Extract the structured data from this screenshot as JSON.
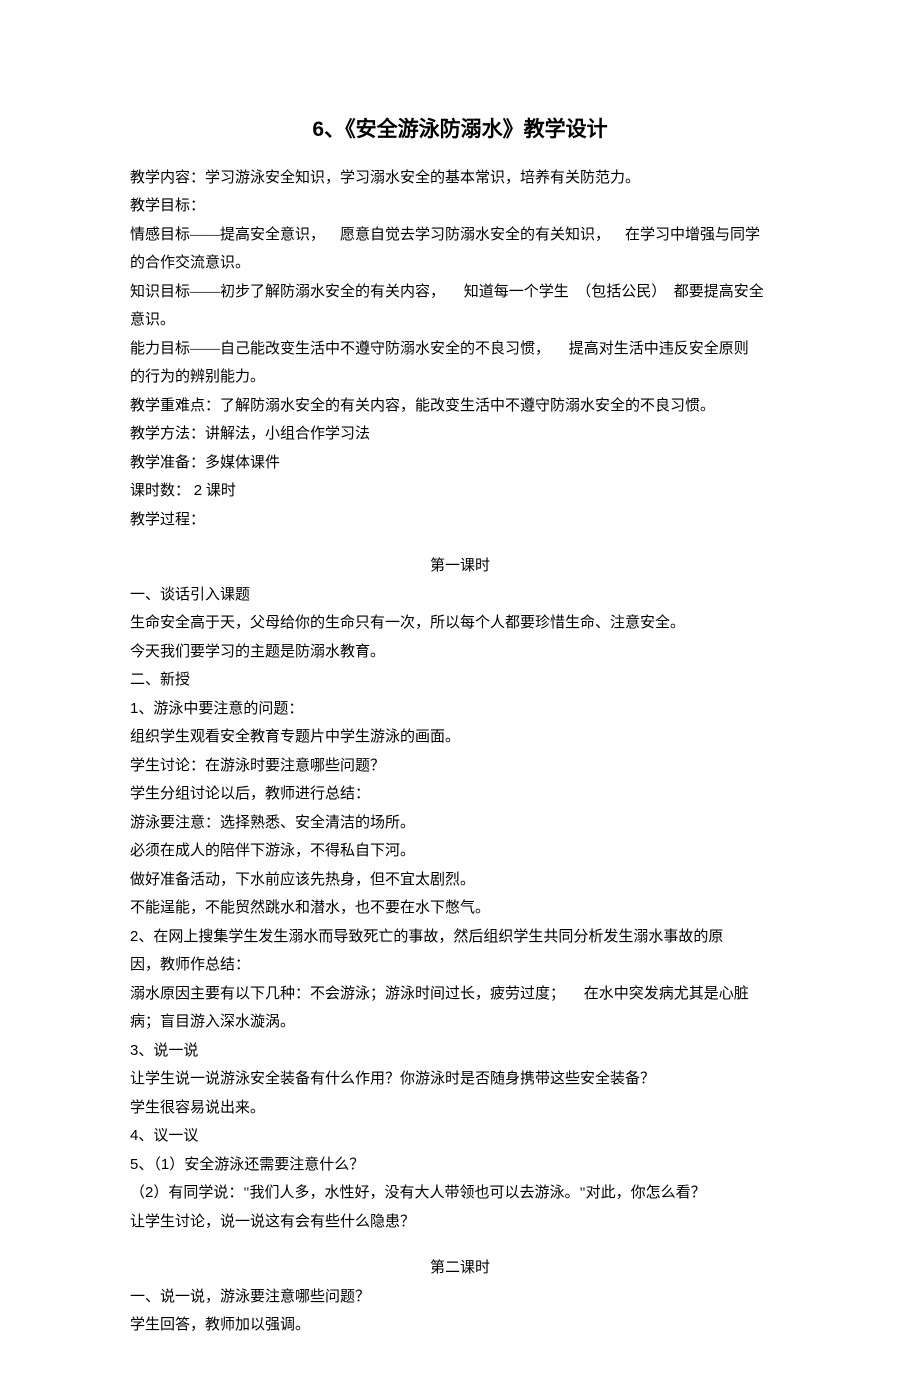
{
  "title": {
    "num": "6",
    "sep": "、",
    "name": "《安全游泳防溺水》教学设计"
  },
  "intro": {
    "content": "教学内容：学习游泳安全知识，学习溺水安全的基本常识，培养有关防范力。",
    "objHeader": "教学目标：",
    "obj1a": "情感目标——提高安全意识，",
    "obj1b": "愿意自觉去学习防溺水安全的有关知识，",
    "obj1c": "在学习中增强与同学",
    "obj1d": "的合作交流意识。",
    "obj2a": "知识目标——初步了解防溺水安全的有关内容，",
    "obj2b": "知道每一个学生",
    "obj2c": "（包括公民）",
    "obj2d": "都要提高安全",
    "obj2e": "意识。",
    "obj3a": "能力目标——自己能改变生活中不遵守防溺水安全的不良习惯，",
    "obj3b": "提高对生活中违反安全原则",
    "obj3c": "的行为的辨别能力。",
    "difficulty": "教学重难点：了解防溺水安全的有关内容，能改变生活中不遵守防溺水安全的不良习惯。",
    "method": "教学方法：讲解法，小组合作学习法",
    "prep": "教学准备：多媒体课件",
    "periodsLabel": "课时数：",
    "periodsNum": "2",
    "periodsUnit": " 课时",
    "processHeader": "教学过程："
  },
  "lesson1": {
    "header": "第一课时",
    "s1": "一、谈话引入课题",
    "s1a": "生命安全高于天，父母给你的生命只有一次，所以每个人都要珍惜生命、注意安全。",
    "s1b": "今天我们要学习的主题是防溺水教育。",
    "s2": "二、新授",
    "p1n": "1",
    "p1": "、游泳中要注意的问题：",
    "p1a": "组织学生观看安全教育专题片中学生游泳的画面。",
    "p1b": "学生讨论：在游泳时要注意哪些问题？",
    "p1c": "学生分组讨论以后，教师进行总结：",
    "p1d": "游泳要注意：选择熟悉、安全清洁的场所。",
    "p1e": "必须在成人的陪伴下游泳，不得私自下河。",
    "p1f": "做好准备活动，下水前应该先热身，但不宜太剧烈。",
    "p1g": "不能逞能，不能贸然跳水和潜水，也不要在水下憋气。",
    "p2n": "2",
    "p2": "、在网上搜集学生发生溺水而导致死亡的事故，然后组织学生共同分析发生溺水事故的原",
    "p2b": "因，教师作总结：",
    "p2c1": "溺水原因主要有以下几种：不会游泳；游泳时间过长，疲劳过度；",
    "p2c2": "在水中突发病尤其是心脏",
    "p2d": "病；盲目游入深水漩涡。",
    "p3n": "3",
    "p3": "、说一说",
    "p3a": "让学生说一说游泳安全装备有什么作用？你游泳时是否随身携带这些安全装备？",
    "p3b": "学生很容易说出来。",
    "p4n": "4",
    "p4": "、议一议",
    "p5n": "5",
    "p5n2": "1",
    "p5a": "、（",
    "p5b": "）安全游泳还需要注意什么？",
    "p6n": "2",
    "p6a": "（",
    "p6b": "）有同学说：\"我们人多，水性好，没有大人带领也可以去游泳。\"对此，你怎么看？",
    "p6c": "让学生讨论，说一说这有会有些什么隐患？"
  },
  "lesson2": {
    "header": "第二课时",
    "s1": "一、说一说，游泳要注意哪些问题？",
    "s1a": "学生回答，教师加以强调。"
  }
}
